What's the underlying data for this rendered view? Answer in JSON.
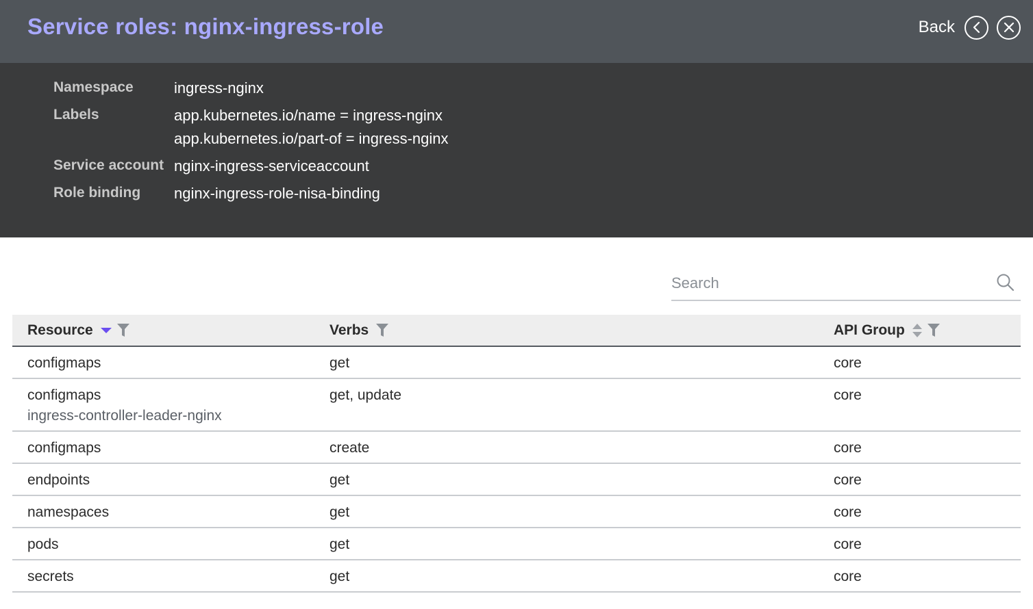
{
  "header": {
    "title": "Service roles: nginx-ingress-role",
    "back_label": "Back",
    "back_icon": "chevron-left-icon",
    "close_icon": "close-icon"
  },
  "details": {
    "namespace_label": "Namespace",
    "namespace_value": "ingress-nginx",
    "labels_label": "Labels",
    "labels_values": [
      "app.kubernetes.io/name = ingress-nginx",
      "app.kubernetes.io/part-of = ingress-nginx"
    ],
    "service_account_label": "Service account",
    "service_account_value": "nginx-ingress-serviceaccount",
    "role_binding_label": "Role binding",
    "role_binding_value": "nginx-ingress-role-nisa-binding"
  },
  "search": {
    "placeholder": "Search",
    "value": ""
  },
  "table": {
    "columns": [
      "Resource",
      "Verbs",
      "API Group"
    ],
    "rows": [
      {
        "resource": "configmaps",
        "resource_name": "",
        "verbs": "get",
        "api_group": "core"
      },
      {
        "resource": "configmaps",
        "resource_name": "ingress-controller-leader-nginx",
        "verbs": "get, update",
        "api_group": "core"
      },
      {
        "resource": "configmaps",
        "resource_name": "",
        "verbs": "create",
        "api_group": "core"
      },
      {
        "resource": "endpoints",
        "resource_name": "",
        "verbs": "get",
        "api_group": "core"
      },
      {
        "resource": "namespaces",
        "resource_name": "",
        "verbs": "get",
        "api_group": "core"
      },
      {
        "resource": "pods",
        "resource_name": "",
        "verbs": "get",
        "api_group": "core"
      },
      {
        "resource": "secrets",
        "resource_name": "",
        "verbs": "get",
        "api_group": "core"
      }
    ]
  },
  "colors": {
    "title": "#a9a9ff",
    "header_bg": "#50555a",
    "details_bg": "#3a3b3c",
    "sort_active": "#6b4ef0"
  }
}
